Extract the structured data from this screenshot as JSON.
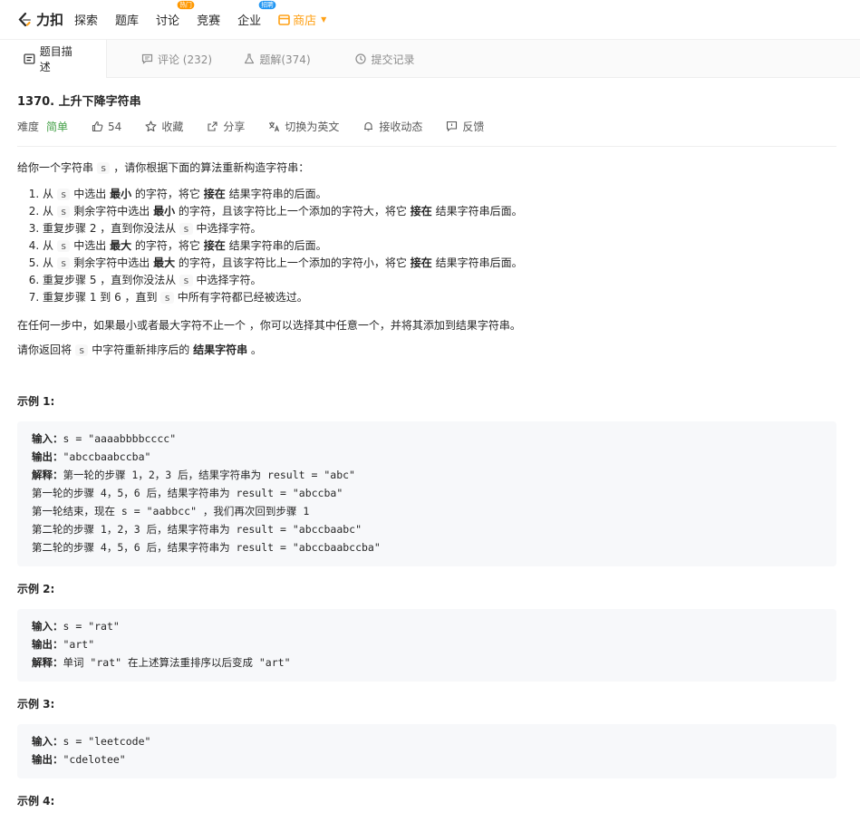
{
  "nav": {
    "logo_text": "力扣",
    "items": [
      {
        "label": "探索"
      },
      {
        "label": "题库"
      },
      {
        "label": "讨论",
        "badge": "热门"
      },
      {
        "label": "竞赛"
      },
      {
        "label": "企业",
        "badge": "招聘"
      }
    ],
    "store_label": "商店",
    "accent": "#ffa116"
  },
  "tabs": [
    {
      "label": "题目描述",
      "icon": "description-icon"
    },
    {
      "label": "评论 (232)",
      "icon": "comment-icon"
    },
    {
      "label": "题解(374)",
      "icon": "flask-icon"
    },
    {
      "label": "提交记录",
      "icon": "clock-icon"
    }
  ],
  "problem": {
    "title": "1370. 上升下降字符串",
    "difficulty_label": "难度",
    "difficulty": "简单",
    "likes": "54",
    "actions": [
      "收藏",
      "分享",
      "切换为英文",
      "接收动态",
      "反馈"
    ]
  },
  "desc": {
    "intro_a": "给你一个字符串 ",
    "intro_var": "s",
    "intro_b": " ，请你根据下面的算法重新构造字符串：",
    "steps": [
      {
        "a": "从 ",
        "v": "s",
        "b": " 中选出 ",
        "bold1": "最小",
        "c": " 的字符，将它 ",
        "bold2": "接在",
        "d": " 结果字符串的后面。"
      },
      {
        "a": "从 ",
        "v": "s",
        "b": " 剩余字符中选出 ",
        "bold1": "最小",
        "c": " 的字符，且该字符比上一个添加的字符大，将它 ",
        "bold2": "接在",
        "d": " 结果字符串后面。"
      },
      {
        "a": "重复步骤 2 ，直到你没法从 ",
        "v": "s",
        "b": " 中选择字符。"
      },
      {
        "a": "从 ",
        "v": "s",
        "b": " 中选出 ",
        "bold1": "最大",
        "c": " 的字符，将它 ",
        "bold2": "接在",
        "d": " 结果字符串的后面。"
      },
      {
        "a": "从 ",
        "v": "s",
        "b": " 剩余字符中选出 ",
        "bold1": "最大",
        "c": " 的字符，且该字符比上一个添加的字符小，将它 ",
        "bold2": "接在",
        "d": " 结果字符串后面。"
      },
      {
        "a": "重复步骤 5 ，直到你没法从 ",
        "v": "s",
        "b": " 中选择字符。"
      },
      {
        "a": "重复步骤 1 到 6 ，直到 ",
        "v": "s",
        "b": " 中所有字符都已经被选过。"
      }
    ],
    "para1": "在任何一步中，如果最小或者最大字符不止一个 ，你可以选择其中任意一个，并将其添加到结果字符串。",
    "para2_a": "请你返回将 ",
    "para2_var": "s",
    "para2_b": " 中字符重新排序后的 ",
    "para2_bold": "结果字符串",
    "para2_c": " 。"
  },
  "examples": [
    {
      "title": "示例 1:",
      "lines": [
        {
          "k": "输入：",
          "t": "s = \"aaaabbbbcccc\""
        },
        {
          "k": "输出：",
          "t": "\"abccbaabccba\""
        },
        {
          "k": "解释：",
          "t": "第一轮的步骤 1，2，3 后，结果字符串为 result = \"abc\""
        },
        {
          "k": "",
          "t": "第一轮的步骤 4，5，6 后，结果字符串为 result = \"abccba\""
        },
        {
          "k": "",
          "t": "第一轮结束，现在 s = \"aabbcc\" ，我们再次回到步骤 1"
        },
        {
          "k": "",
          "t": "第二轮的步骤 1，2，3 后，结果字符串为 result = \"abccbaabc\""
        },
        {
          "k": "",
          "t": "第二轮的步骤 4，5，6 后，结果字符串为 result = \"abccbaabccba\""
        }
      ]
    },
    {
      "title": "示例 2:",
      "lines": [
        {
          "k": "输入：",
          "t": "s = \"rat\""
        },
        {
          "k": "输出：",
          "t": "\"art\""
        },
        {
          "k": "解释：",
          "t": "单词 \"rat\" 在上述算法重排序以后变成 \"art\""
        }
      ]
    },
    {
      "title": "示例 3:",
      "lines": [
        {
          "k": "输入：",
          "t": "s = \"leetcode\""
        },
        {
          "k": "输出：",
          "t": "\"cdelotee\""
        }
      ]
    },
    {
      "title": "示例 4:",
      "lines": []
    }
  ]
}
